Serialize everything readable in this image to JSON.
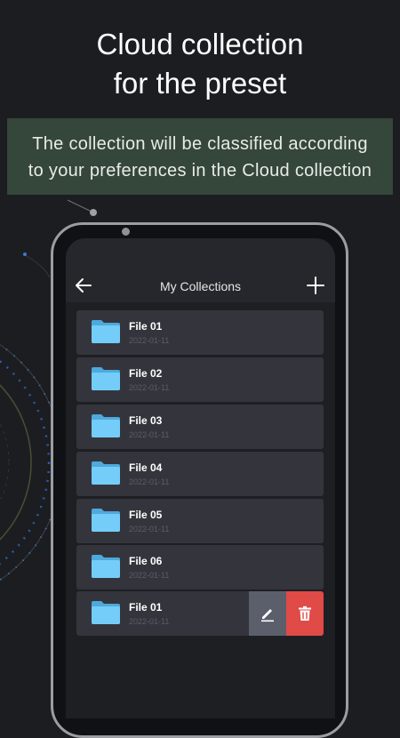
{
  "headline": {
    "line1": "Cloud collection",
    "line2": "for the preset"
  },
  "subtitle": {
    "line1": "The collection will be classified according",
    "line2": "to your preferences in the Cloud collection"
  },
  "app": {
    "header": {
      "title": "My Collections",
      "back_icon": "arrow-left-icon",
      "add_icon": "plus-icon"
    },
    "items": [
      {
        "name": "File 01",
        "date": "2022-01-11"
      },
      {
        "name": "File 02",
        "date": "2022-01-11"
      },
      {
        "name": "File 03",
        "date": "2022-01-11"
      },
      {
        "name": "File 04",
        "date": "2022-01-11"
      },
      {
        "name": "File 05",
        "date": "2022-01-11"
      },
      {
        "name": "File 06",
        "date": "2022-01-11"
      },
      {
        "name": "File 01",
        "date": "2022-01-11"
      }
    ],
    "swipe_actions": {
      "edit_icon": "pencil-icon",
      "delete_icon": "trash-icon"
    }
  },
  "colors": {
    "background": "#1c1d21",
    "subtitle_bg": "#35463a",
    "list_item_bg": "#34353c",
    "folder": "#6cc6f5",
    "edit_action": "#5b5e6b",
    "delete_action": "#e04a47"
  }
}
